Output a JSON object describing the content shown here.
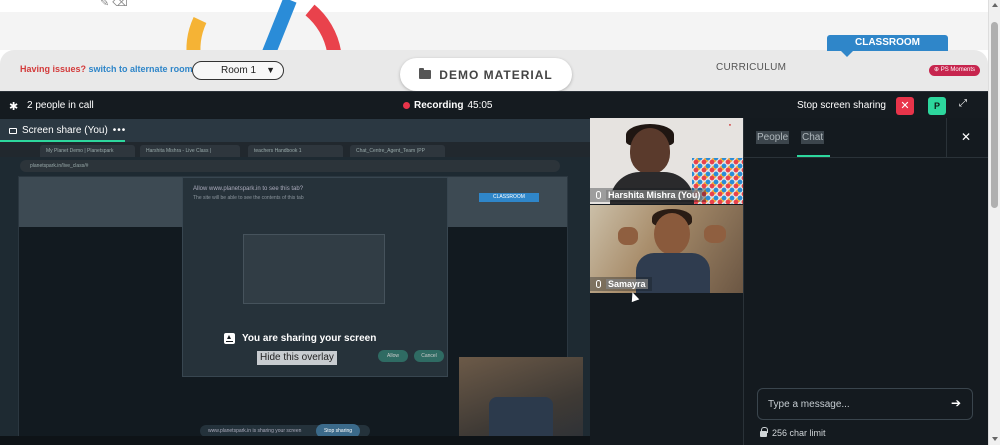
{
  "site": {
    "issues_text": "Having issues?",
    "alt_link": "switch to alternate room",
    "room_select": "Room 1",
    "demo_button": "DEMO MATERIAL",
    "curriculum": "CURRICULUM",
    "classroom": "CLASSROOM",
    "ps_badge": "PS Moments"
  },
  "call": {
    "people_count": "2 people in call",
    "recording_label": "Recording",
    "recording_time": "45:05",
    "stop_sharing": "Stop screen sharing",
    "avatar_initial": "P",
    "share_tab_label": "Screen share (You)",
    "sharing_overlay_text": "You are sharing your screen",
    "hide_overlay": "Hide this overlay"
  },
  "participants": [
    {
      "name": "Harshita Mishra (You)"
    },
    {
      "name": "Samayra"
    }
  ],
  "sidebar": {
    "tab_people": "People",
    "tab_chat": "Chat",
    "message_placeholder": "Type a message...",
    "char_limit": "256 char limit"
  },
  "shared_screen": {
    "tabs": [
      "My Planet Demo | Planetspark",
      "Harshita Mishra - Live Class |",
      "teachers Handbook 1",
      "Chat_Centre_Agent_Team (PP"
    ],
    "url": "planetspark.in/live_class/#",
    "perm_title": "Allow www.planetspark.in to see this tab?",
    "perm_sub": "The site will be able to see the contents of this tab",
    "allow": "Allow",
    "cancel": "Cancel",
    "bottom_bar": "www.planetspark.in is sharing your screen",
    "stop_sharing": "Stop sharing",
    "classroom": "CLASSROOM"
  }
}
